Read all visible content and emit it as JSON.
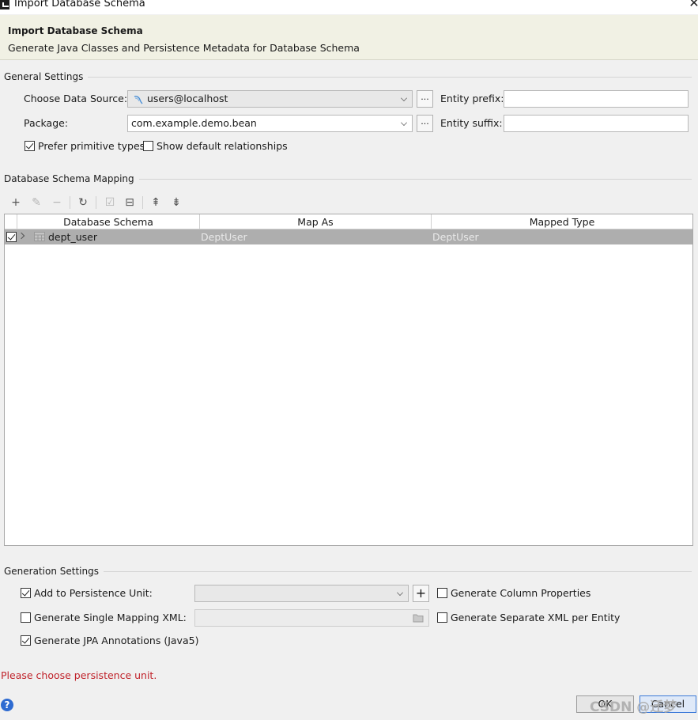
{
  "window": {
    "title": "Import Database Schema",
    "close_glyph": "✕"
  },
  "banner": {
    "title": "Import Database Schema",
    "subtitle": "Generate Java Classes and Persistence Metadata for Database Schema"
  },
  "general": {
    "section": "General Settings",
    "data_source_label": "Choose Data Source:",
    "data_source_value": "users@localhost",
    "package_label": "Package:",
    "package_value": "com.example.demo.bean",
    "browse_glyph": "...",
    "entity_prefix_label": "Entity prefix:",
    "entity_prefix_value": "",
    "entity_suffix_label": "Entity suffix:",
    "entity_suffix_value": "",
    "prefer_primitive_label": "Prefer primitive types",
    "prefer_primitive_checked": true,
    "show_default_rel_label": "Show default relationships",
    "show_default_rel_checked": false
  },
  "mapping": {
    "section": "Database Schema Mapping",
    "toolbar": {
      "add": "+",
      "edit": "✎",
      "remove": "−",
      "refresh": "↻",
      "check_all": "☑",
      "uncheck_all": "⊟",
      "expand_all": "⇞",
      "collapse_all": "⇟"
    },
    "columns": [
      "Database Schema",
      "Map As",
      "Mapped Type"
    ],
    "rows": [
      {
        "checked": true,
        "schema": "dept_user",
        "map_as": "DeptUser",
        "mapped_type": "DeptUser"
      }
    ]
  },
  "generation": {
    "section": "Generation Settings",
    "add_to_pu_label": "Add to Persistence Unit:",
    "add_to_pu_checked": true,
    "pu_value": "",
    "add_pu_glyph": "+",
    "single_xml_label": "Generate Single Mapping XML:",
    "single_xml_checked": false,
    "single_xml_value": "",
    "jpa_annotations_label": "Generate JPA Annotations (Java5)",
    "jpa_annotations_checked": true,
    "column_props_label": "Generate Column Properties",
    "column_props_checked": false,
    "separate_xml_label": "Generate Separate XML per Entity",
    "separate_xml_checked": false
  },
  "footer": {
    "error": "Please choose persistence unit.",
    "help_glyph": "?",
    "ok_label": "OK",
    "cancel_label": "Cancel",
    "watermark": "CSDN @迁梦"
  },
  "colors": {
    "banner_bg": "#f1f1e4",
    "error_text": "#c0222a",
    "selected_row": "#aeaeae",
    "help_blue": "#2e6bd1"
  }
}
